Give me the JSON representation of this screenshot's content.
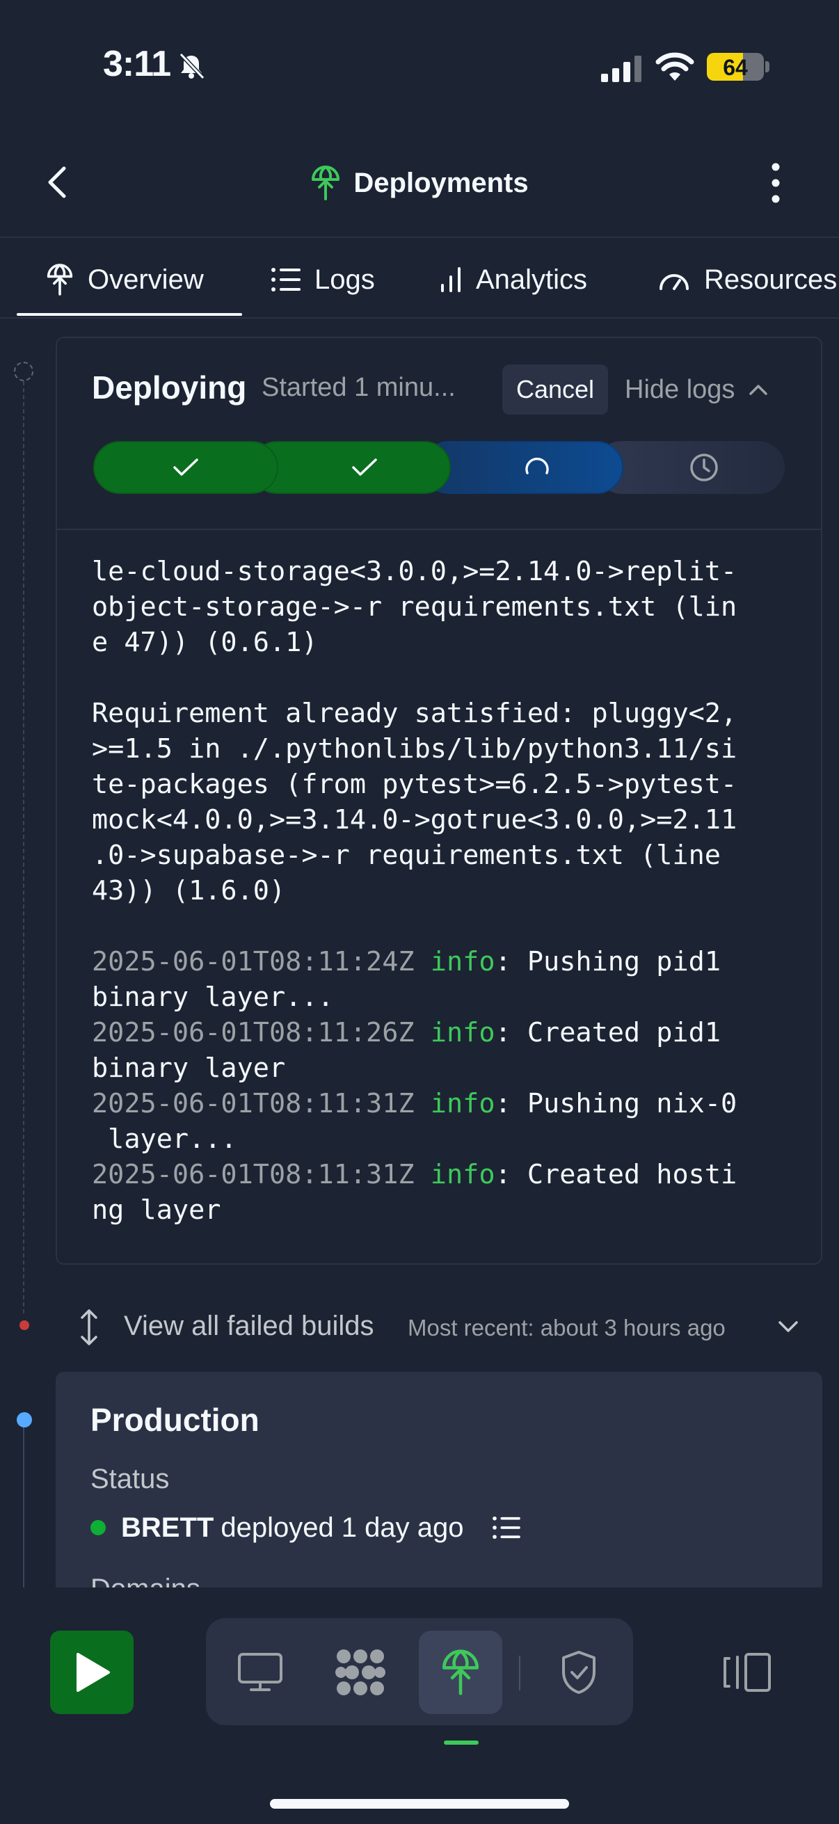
{
  "status_bar": {
    "time": "3:11",
    "battery": "64",
    "battery_fraction": 0.64
  },
  "header": {
    "title": "Deployments",
    "icon": "deployments-icon",
    "back_icon": "chevron-left-icon",
    "more_icon": "more-vertical-icon"
  },
  "tabs": [
    {
      "label": "Overview",
      "icon": "deployments-icon",
      "active": true
    },
    {
      "label": "Logs",
      "icon": "list-icon"
    },
    {
      "label": "Analytics",
      "icon": "bar-chart-icon"
    },
    {
      "label": "Resources",
      "icon": "gauge-icon"
    }
  ],
  "deploy": {
    "title": "Deploying",
    "started": "Started 1 minu...",
    "cancel_label": "Cancel",
    "hide_logs_label": "Hide logs",
    "steps": [
      {
        "state": "done",
        "icon": "check-icon"
      },
      {
        "state": "done",
        "icon": "check-icon"
      },
      {
        "state": "in-progress",
        "icon": "spinner-icon"
      },
      {
        "state": "pending",
        "icon": "clock-icon"
      }
    ]
  },
  "logs": {
    "block1": [
      "le-cloud-storage<3.0.0,>=2.14.0->replit-",
      "object-storage->-r requirements.txt (lin",
      "e 47)) (0.6.1)"
    ],
    "block2": [
      "Requirement already satisfied: pluggy<2,",
      ">=1.5 in ./.pythonlibs/lib/python3.11/si",
      "te-packages (from pytest>=6.2.5->pytest-",
      "mock<4.0.0,>=3.14.0->gotrue<3.0.0,>=2.11",
      ".0->supabase->-r requirements.txt (line",
      "43)) (1.6.0)"
    ],
    "entries": [
      {
        "ts": "2025-06-01T08:11:24Z",
        "level": "info",
        "msg1": ": Pushing pid1",
        "msg2": "binary layer..."
      },
      {
        "ts": "2025-06-01T08:11:26Z",
        "level": "info",
        "msg1": ": Created pid1",
        "msg2": "binary layer"
      },
      {
        "ts": "2025-06-01T08:11:31Z",
        "level": "info",
        "msg1": ": Pushing nix-0",
        "msg2": " layer..."
      },
      {
        "ts": "2025-06-01T08:11:31Z",
        "level": "info",
        "msg1": ": Created hosti",
        "msg2": "ng layer"
      }
    ]
  },
  "failed_builds": {
    "label": "View all failed builds",
    "recent": "Most recent: about 3 hours ago"
  },
  "production": {
    "title": "Production",
    "status_label": "Status",
    "user": "BRETT",
    "deployed_text": "deployed 1 day ago",
    "next_label": "Domains"
  },
  "bottom_bar": {
    "run_icon": "play-icon",
    "tools": [
      "monitor-icon",
      "workspace-icon",
      "deployments-icon",
      "shield-check-icon"
    ],
    "panel_icon": "panel-switch-icon"
  },
  "colors": {
    "background": "#1c2333",
    "surface": "#2b3245",
    "success": "#0a6e1f",
    "accent_green": "#3ec95a",
    "progress_blue": "#0d4b91",
    "failed_dot": "#c93c3c",
    "production_dot": "#57abff"
  }
}
